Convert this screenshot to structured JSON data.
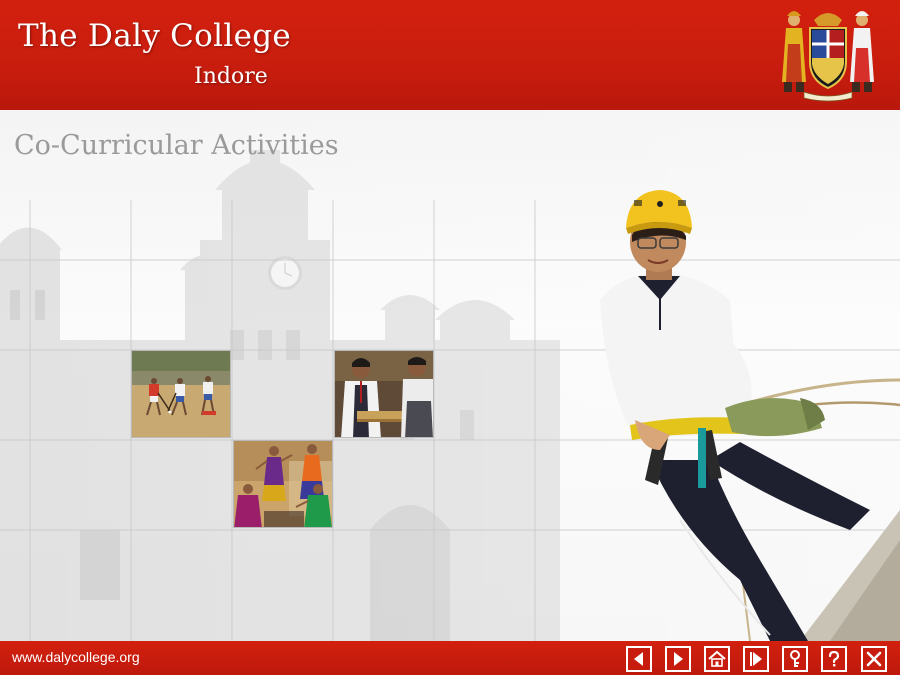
{
  "header": {
    "college_name": "The Daly College",
    "college_city": "Indore"
  },
  "main": {
    "page_title": "Co-Curricular Activities",
    "photos": [
      {
        "name": "hockey-photo"
      },
      {
        "name": "woodwork-photo"
      },
      {
        "name": "dance-photo"
      },
      {
        "name": "rappelling-photo"
      }
    ]
  },
  "footer": {
    "website": "www.dalycollege.org",
    "nav_buttons": [
      {
        "name": "previous-button",
        "icon": "arrow-left-icon"
      },
      {
        "name": "next-button",
        "icon": "arrow-right-icon"
      },
      {
        "name": "home-button",
        "icon": "home-icon"
      },
      {
        "name": "play-button",
        "icon": "play-icon"
      },
      {
        "name": "key-button",
        "icon": "key-icon"
      },
      {
        "name": "help-button",
        "icon": "question-icon"
      },
      {
        "name": "close-button",
        "icon": "close-icon"
      }
    ]
  },
  "colors": {
    "brand_red": "#c81d0e",
    "title_grey": "#9a9a9a",
    "white": "#ffffff"
  }
}
